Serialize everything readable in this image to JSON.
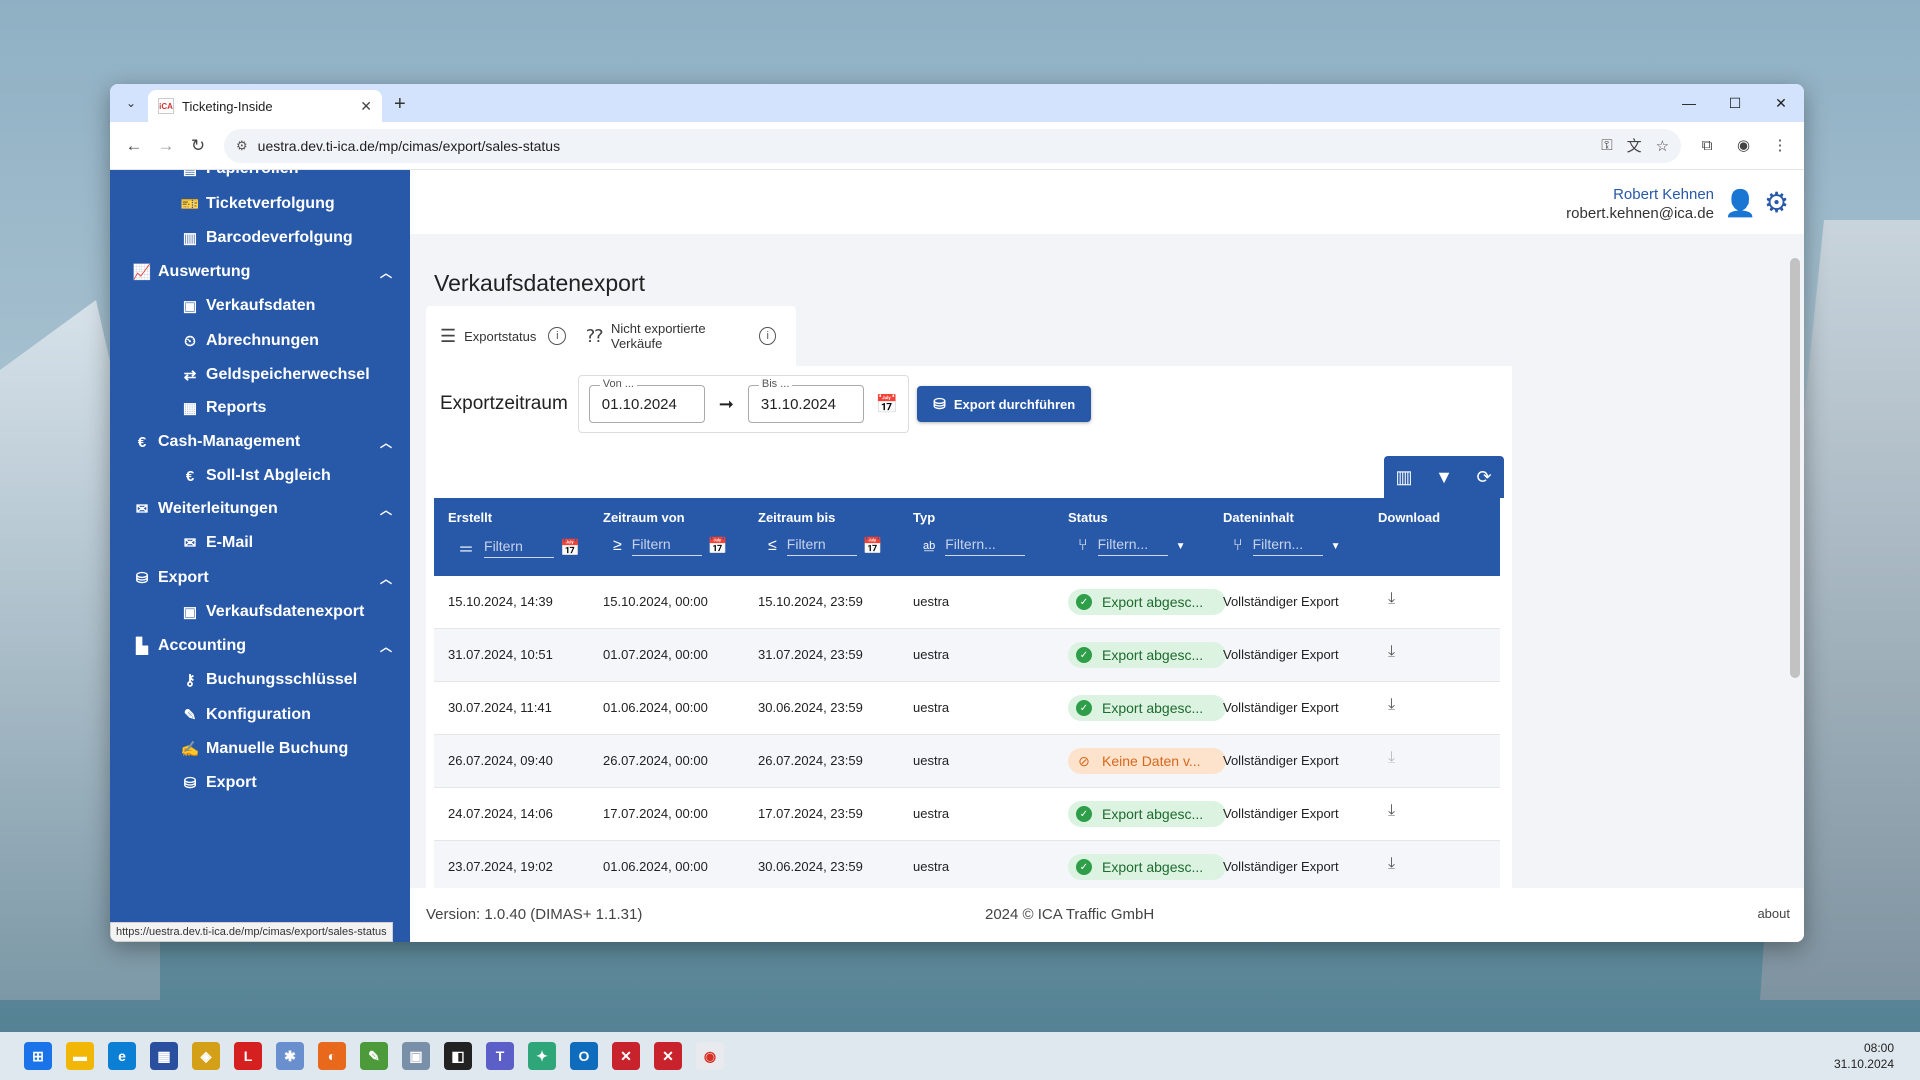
{
  "browser": {
    "tab_title": "Ticketing-Inside",
    "url": "uestra.dev.ti-ica.de/mp/cimas/export/sales-status",
    "status_url": "https://uestra.dev.ti-ica.de/mp/cimas/export/sales-status"
  },
  "sidebar": {
    "items": [
      {
        "label": "Papierrollen"
      },
      {
        "label": "Ticketverfolgung"
      },
      {
        "label": "Barcodeverfolgung"
      },
      {
        "label": "Auswertung"
      },
      {
        "label": "Verkaufsdaten"
      },
      {
        "label": "Abrechnungen"
      },
      {
        "label": "Geldspeicherwechsel"
      },
      {
        "label": "Reports"
      },
      {
        "label": "Cash-Management"
      },
      {
        "label": "Soll-Ist Abgleich"
      },
      {
        "label": "Weiterleitungen"
      },
      {
        "label": "E-Mail"
      },
      {
        "label": "Export"
      },
      {
        "label": "Verkaufsdatenexport"
      },
      {
        "label": "Accounting"
      },
      {
        "label": "Buchungsschlüssel"
      },
      {
        "label": "Konfiguration"
      },
      {
        "label": "Manuelle Buchung"
      },
      {
        "label": "Export"
      }
    ]
  },
  "header": {
    "user_name": "Robert Kehnen",
    "user_email": "robert.kehnen@ica.de"
  },
  "page": {
    "title": "Verkaufsdatenexport",
    "tabs": [
      {
        "label": "Exportstatus"
      },
      {
        "label": "Nicht exportierte Verkäufe"
      }
    ],
    "export_label": "Exportzeitraum",
    "from_label": "Von ...",
    "from_value": "01.10.2024",
    "to_label": "Bis ...",
    "to_value": "31.10.2024",
    "export_button": "Export durchführen"
  },
  "table": {
    "columns": [
      "Erstellt",
      "Zeitraum von",
      "Zeitraum bis",
      "Typ",
      "Status",
      "Dateninhalt",
      "Download"
    ],
    "filter_placeholder_short": "Filtern",
    "filter_placeholder": "Filtern...",
    "rows": [
      {
        "created": "15.10.2024, 14:39",
        "from": "15.10.2024, 00:00",
        "to": "15.10.2024, 23:59",
        "type": "uestra",
        "status": "Export abgesc...",
        "status_kind": "ok",
        "content": "Vollständiger Export"
      },
      {
        "created": "31.07.2024, 10:51",
        "from": "01.07.2024, 00:00",
        "to": "31.07.2024, 23:59",
        "type": "uestra",
        "status": "Export abgesc...",
        "status_kind": "ok",
        "content": "Vollständiger Export"
      },
      {
        "created": "30.07.2024, 11:41",
        "from": "01.06.2024, 00:00",
        "to": "30.06.2024, 23:59",
        "type": "uestra",
        "status": "Export abgesc...",
        "status_kind": "ok",
        "content": "Vollständiger Export"
      },
      {
        "created": "26.07.2024, 09:40",
        "from": "26.07.2024, 00:00",
        "to": "26.07.2024, 23:59",
        "type": "uestra",
        "status": "Keine Daten v...",
        "status_kind": "warn",
        "content": "Vollständiger Export"
      },
      {
        "created": "24.07.2024, 14:06",
        "from": "17.07.2024, 00:00",
        "to": "17.07.2024, 23:59",
        "type": "uestra",
        "status": "Export abgesc...",
        "status_kind": "ok",
        "content": "Vollständiger Export"
      },
      {
        "created": "23.07.2024, 19:02",
        "from": "01.06.2024, 00:00",
        "to": "30.06.2024, 23:59",
        "type": "uestra",
        "status": "Export abgesc...",
        "status_kind": "ok",
        "content": "Vollständiger Export"
      }
    ]
  },
  "footer": {
    "version": "Version: 1.0.40 (DIMAS+ 1.1.31)",
    "copyright": "2024 © ICA Traffic GmbH",
    "about": "about"
  },
  "taskbar": {
    "time": "08:00",
    "date": "31.10.2024"
  },
  "colors": {
    "primary": "#2858a8",
    "ok_bg": "#ddf3e2",
    "warn_bg": "#fde3cc"
  }
}
